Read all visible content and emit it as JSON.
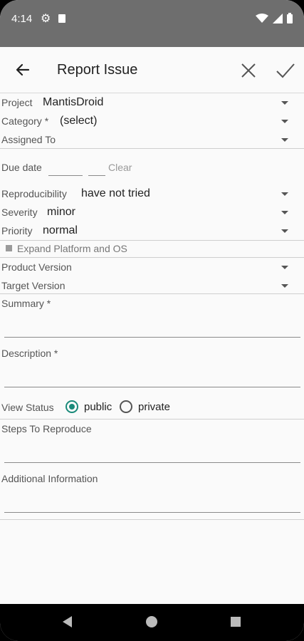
{
  "status": {
    "time": "4:14"
  },
  "appbar": {
    "title": "Report Issue"
  },
  "form": {
    "project": {
      "label": "Project",
      "value": "MantisDroid"
    },
    "category": {
      "label": "Category *",
      "value": "(select)"
    },
    "assigned_to": {
      "label": "Assigned To",
      "value": ""
    },
    "due_date": {
      "label": "Due date",
      "clear": "Clear"
    },
    "reproducibility": {
      "label": "Reproducibility",
      "value": "have not tried"
    },
    "severity": {
      "label": "Severity",
      "value": "minor"
    },
    "priority": {
      "label": "Priority",
      "value": "normal"
    },
    "expand_platform": "Expand Platform and OS",
    "product_version": {
      "label": "Product Version",
      "value": ""
    },
    "target_version": {
      "label": "Target Version",
      "value": ""
    },
    "summary": {
      "label": "Summary *",
      "value": ""
    },
    "description": {
      "label": "Description *",
      "value": ""
    },
    "view_status": {
      "label": "View Status",
      "options": [
        "public",
        "private"
      ],
      "selected": "public"
    },
    "steps_to_reproduce": {
      "label": "Steps To Reproduce",
      "value": ""
    },
    "additional_information": {
      "label": "Additional Information",
      "value": ""
    }
  },
  "colors": {
    "statusbar": "#6e6e6e",
    "accent": "#1a8a7a",
    "background": "#fafafa"
  }
}
